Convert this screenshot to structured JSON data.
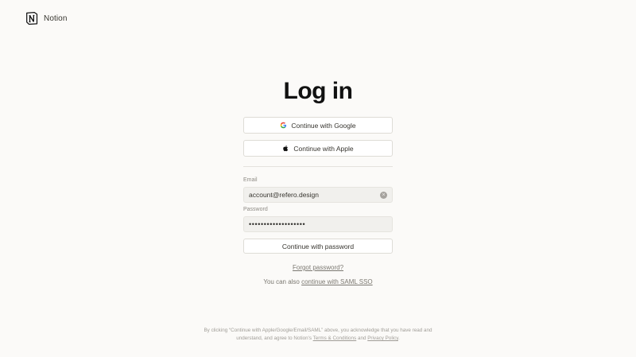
{
  "brand": {
    "name": "Notion",
    "icon": "notion-logo-icon"
  },
  "login": {
    "title": "Log in",
    "google_label": "Continue with Google",
    "apple_label": "Continue with Apple",
    "email_label": "Email",
    "email_value": "account@refero.design",
    "password_label": "Password",
    "password_value": "•••••••••••••••••••",
    "continue_label": "Continue with password",
    "forgot_label": "Forgot password?",
    "saml_prefix": "You can also",
    "saml_link": "continue with SAML SSO"
  },
  "legal": {
    "line1": "By clicking “Continue with Apple/Google/Email/SAML” above, you acknowledge that you have read and understand, and agree to Notion's",
    "terms_link": "Terms & Conditions",
    "and": "and",
    "privacy_link": "Privacy Policy",
    "period": "."
  },
  "colors": {
    "background": "#fbfaf8",
    "text": "#37352f",
    "muted": "#7b7871",
    "field_bg": "#f1f0ed"
  }
}
